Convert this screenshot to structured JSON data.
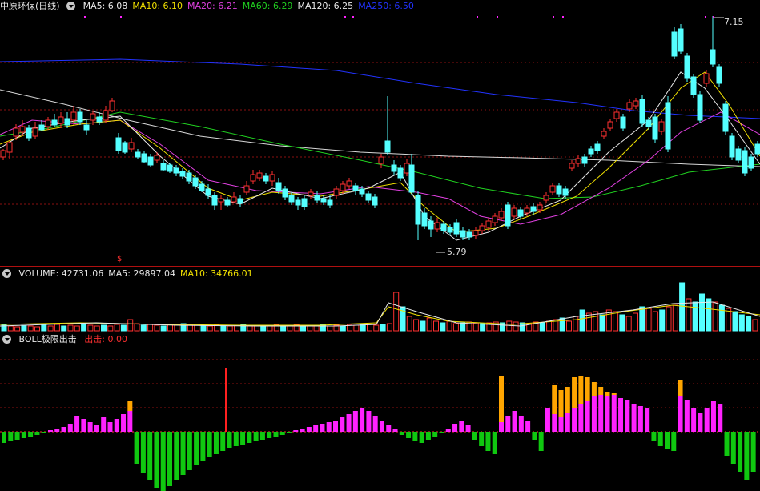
{
  "main": {
    "title": "中原环保(日线)",
    "indicators": [
      {
        "label": "MA5: 6.08",
        "color": "#e8e8e8"
      },
      {
        "label": "MA10: 6.10",
        "color": "#f0e000"
      },
      {
        "label": "MA20: 6.21",
        "color": "#e040e0"
      },
      {
        "label": "MA60: 6.29",
        "color": "#20d020"
      },
      {
        "label": "MA120: 6.25",
        "color": "#e8e8e8"
      },
      {
        "label": "MA250: 6.50",
        "color": "#2233ff"
      }
    ],
    "high_label": "7.15",
    "low_label": "5.79",
    "marker_symbol": "$"
  },
  "volume": {
    "indicators": [
      {
        "label": "VOLUME: 42731.06",
        "color": "#e8e8e8"
      },
      {
        "label": "MA5: 29897.04",
        "color": "#e8e8e8"
      },
      {
        "label": "MA10: 34766.01",
        "color": "#f0e000"
      }
    ]
  },
  "boll": {
    "title": "BOLL极限出击",
    "indicators": [
      {
        "label": "出击: 0.00",
        "color": "#ff3030"
      }
    ]
  },
  "colors": {
    "up": "#ff3030",
    "down": "#54ffff",
    "grid": "#8a1010",
    "osc_pos": "#ff22ff",
    "osc_neg": "#10c810",
    "osc_hi": "#ffa500"
  }
}
